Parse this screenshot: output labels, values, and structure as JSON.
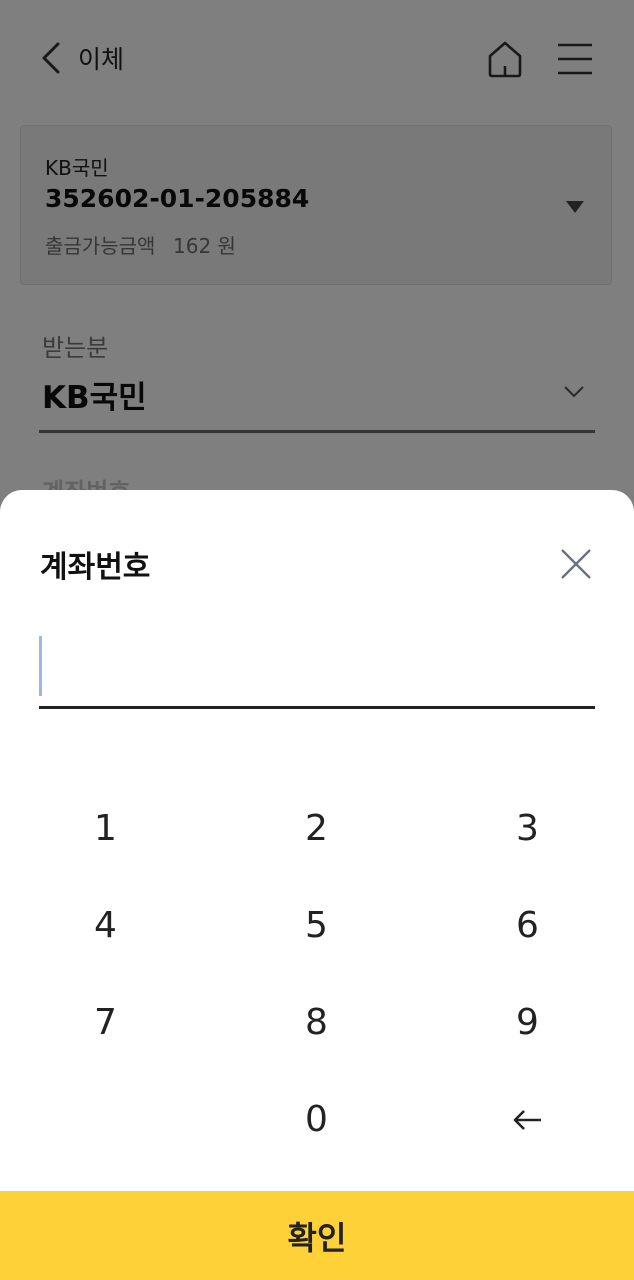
{
  "header": {
    "title": "이체"
  },
  "account": {
    "bank": "KB국민",
    "number": "352602-01-205884",
    "balance_label": "출금가능금액",
    "balance_value": "162 원"
  },
  "recipient": {
    "label": "받는분",
    "bank": "KB국민",
    "next_field_label": "계좌번호"
  },
  "sheet": {
    "title": "계좌번호",
    "input_value": ""
  },
  "keypad": {
    "keys": [
      "1",
      "2",
      "3",
      "4",
      "5",
      "6",
      "7",
      "8",
      "9",
      "",
      "0",
      "backspace"
    ]
  },
  "confirm_label": "확인",
  "colors": {
    "accent": "#fdd137",
    "cursor": "#9fb4ef"
  }
}
